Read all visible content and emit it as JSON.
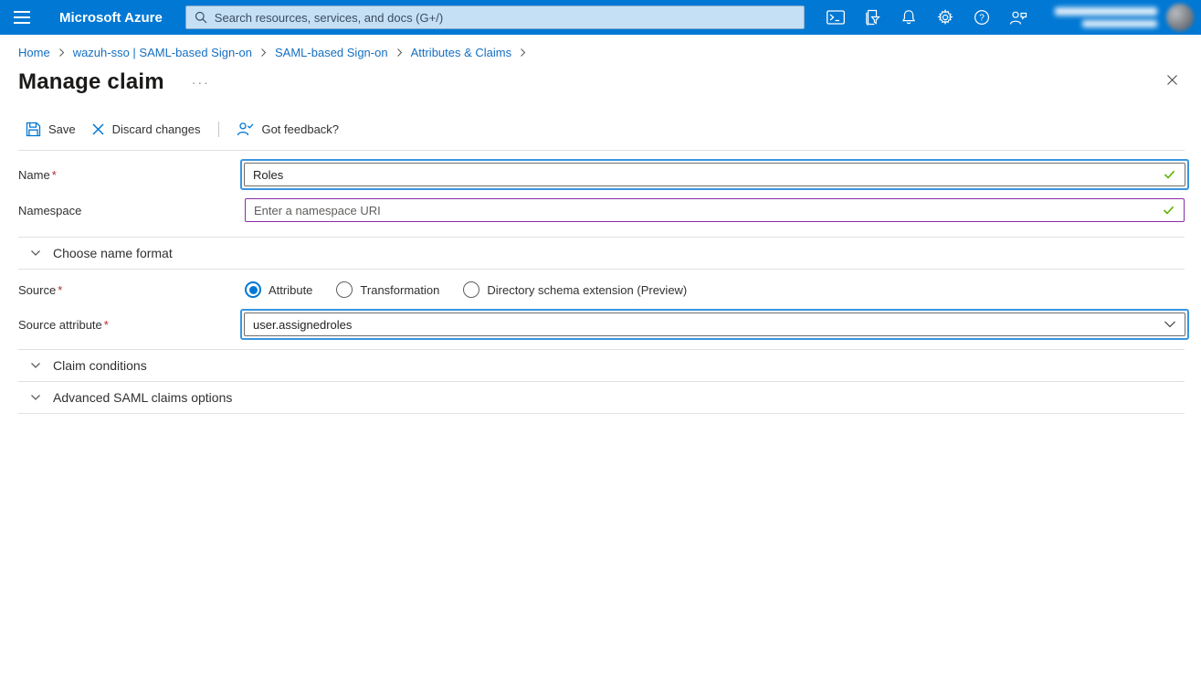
{
  "topbar": {
    "brand": "Microsoft Azure",
    "search": {
      "placeholder": "Search resources, services, and docs (G+/)"
    },
    "icons": [
      "cloud-shell",
      "directory-filter",
      "notifications",
      "settings",
      "help",
      "feedback"
    ],
    "account": {
      "blurred": true
    }
  },
  "breadcrumb": {
    "items": [
      "Home",
      "wazuh-sso | SAML-based Sign-on",
      "SAML-based Sign-on",
      "Attributes & Claims"
    ]
  },
  "page": {
    "title": "Manage claim"
  },
  "toolbar": {
    "save_label": "Save",
    "discard_label": "Discard changes",
    "feedback_label": "Got feedback?"
  },
  "form": {
    "required_marker": "*",
    "name_label": "Name",
    "name_value": "Roles",
    "namespace_label": "Namespace",
    "namespace_placeholder": "Enter a namespace URI",
    "section_name_format": "Choose name format",
    "source_label": "Source",
    "source_options": [
      "Attribute",
      "Transformation",
      "Directory schema extension (Preview)"
    ],
    "source_selected": "Attribute",
    "source_attribute_label": "Source attribute",
    "source_attribute_value": "user.assignedroles",
    "section_claim_conditions": "Claim conditions",
    "section_advanced": "Advanced SAML claims options"
  },
  "colors": {
    "topbar_blue": "#0078d4",
    "search_bg": "#c5dff4",
    "link_blue": "#156fc2",
    "focus_ring_blue": "#3b95df",
    "namespace_border_purple": "#8a2da5",
    "valid_check_green": "#5db300",
    "required_red": "#b02a30",
    "divider_gray": "#e3e1df",
    "label_gray": "#323130"
  }
}
